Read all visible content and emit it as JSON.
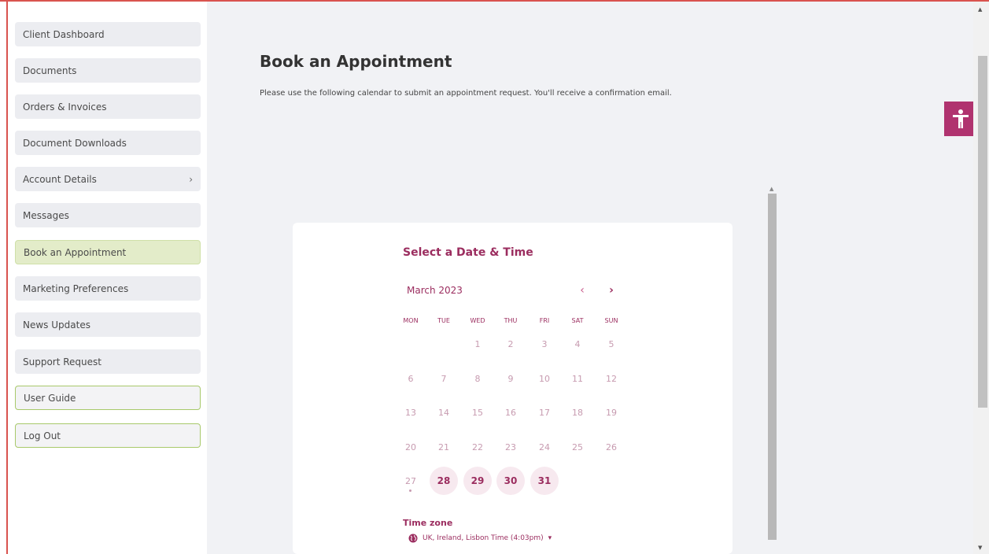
{
  "sidebar": {
    "items": [
      {
        "label": "Client Dashboard"
      },
      {
        "label": "Documents"
      },
      {
        "label": "Orders & Invoices"
      },
      {
        "label": "Document Downloads"
      },
      {
        "label": "Account Details",
        "chevron": "›"
      },
      {
        "label": "Messages"
      },
      {
        "label": "Book an Appointment"
      },
      {
        "label": "Marketing Preferences"
      },
      {
        "label": "News Updates"
      },
      {
        "label": "Support Request"
      },
      {
        "label": "User Guide"
      },
      {
        "label": "Log Out"
      }
    ],
    "active": "Book an Appointment"
  },
  "page": {
    "title": "Book an Appointment",
    "description": "Please use the following calendar to submit an appointment request. You'll receive a confirmation email."
  },
  "accessibility": {
    "icon": "accessibility-person-icon"
  },
  "scheduler": {
    "heading": "Select a Date & Time",
    "month": "March 2023",
    "prev_icon": "‹",
    "next_icon": "›",
    "weekdays": [
      "MON",
      "TUE",
      "WED",
      "THU",
      "FRI",
      "SAT",
      "SUN"
    ],
    "days": {
      "d1": "1",
      "d2": "2",
      "d3": "3",
      "d4": "4",
      "d5": "5",
      "d6": "6",
      "d7": "7",
      "d8": "8",
      "d9": "9",
      "d10": "10",
      "d11": "11",
      "d12": "12",
      "d13": "13",
      "d14": "14",
      "d15": "15",
      "d16": "16",
      "d17": "17",
      "d18": "18",
      "d19": "19",
      "d20": "20",
      "d21": "21",
      "d22": "22",
      "d23": "23",
      "d24": "24",
      "d25": "25",
      "d26": "26",
      "d27": "27",
      "d28": "28",
      "d29": "29",
      "d30": "30",
      "d31": "31"
    },
    "available_days": [
      "28",
      "29",
      "30",
      "31"
    ],
    "today": "27",
    "timezone_label": "Time zone",
    "timezone_value": "UK, Ireland, Lisbon Time (4:03pm)",
    "timezone_caret": "▾"
  },
  "colors": {
    "accent": "#9b2d5f",
    "active_nav": "#e3ecc9",
    "accessibility_button": "#b0336f"
  }
}
